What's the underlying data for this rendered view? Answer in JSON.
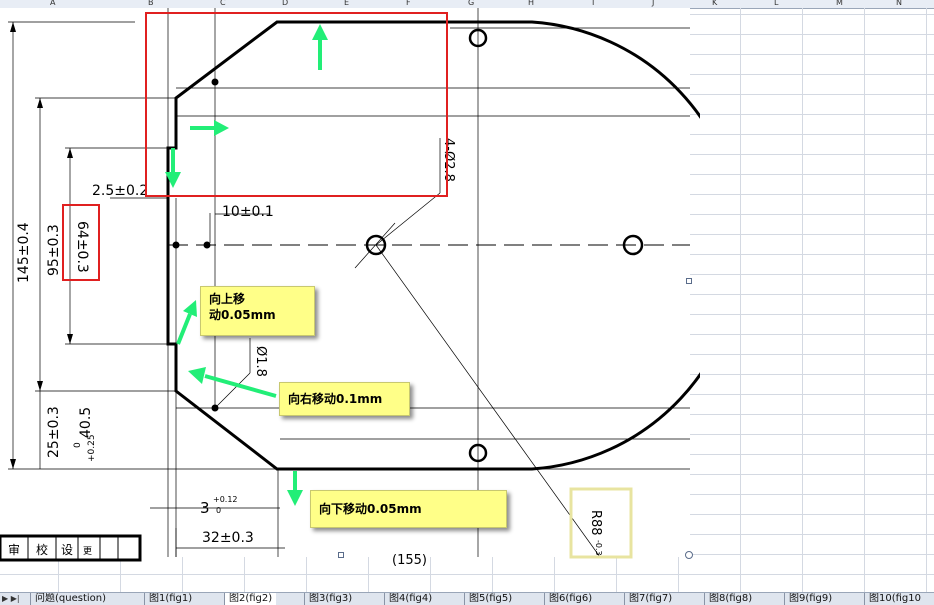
{
  "column_headers": [
    "A",
    "B",
    "C",
    "D",
    "E",
    "F",
    "G",
    "H",
    "I",
    "J",
    "K",
    "L",
    "M",
    "N"
  ],
  "drawing": {
    "dimensions": {
      "overall_height": "145±0.4",
      "height_95": "95±0.3",
      "height_64": "64±0.3",
      "offset_25": "25±0.3",
      "offset_40_5": "40.5",
      "offset_40_5_upper_tol": "+0.25",
      "offset_40_5_lower_tol": "0",
      "edge_2_5": "2.5±0.2",
      "edge_10": "10±0.1",
      "hole_2_8": "4-Ø2.8",
      "hole_1_8": "Ø1.8",
      "depth_3": "3",
      "depth_3_upper_tol": "+0.12",
      "depth_3_lower_tol": "0",
      "width_32": "32±0.3",
      "radius_88": "R88",
      "radius_88_tol": "-0.3",
      "bottom_partial": "(155)"
    },
    "title_block_cells": [
      "审",
      "校",
      "设",
      "更"
    ]
  },
  "notes": {
    "move_up": "向上移\n动0.05mm",
    "move_right": "向右移动0.1mm",
    "move_down": "向下移动0.05mm"
  },
  "sheet_tabs": {
    "nav_arrows": "▶ ▶|",
    "tabs": [
      "问题(question)",
      "图1(fig1)",
      "图2(fig2)",
      "图3(fig3)",
      "图4(fig4)",
      "图5(fig5)",
      "图6(fig6)",
      "图7(fig7)",
      "图8(fig8)",
      "图9(fig9)",
      "图10(fig10"
    ],
    "active_index": 2
  },
  "colors": {
    "highlight_box": "#e02020",
    "arrow": "#22ee77",
    "note_bg": "#ffff88",
    "radius_box": "#e8e4a0"
  }
}
